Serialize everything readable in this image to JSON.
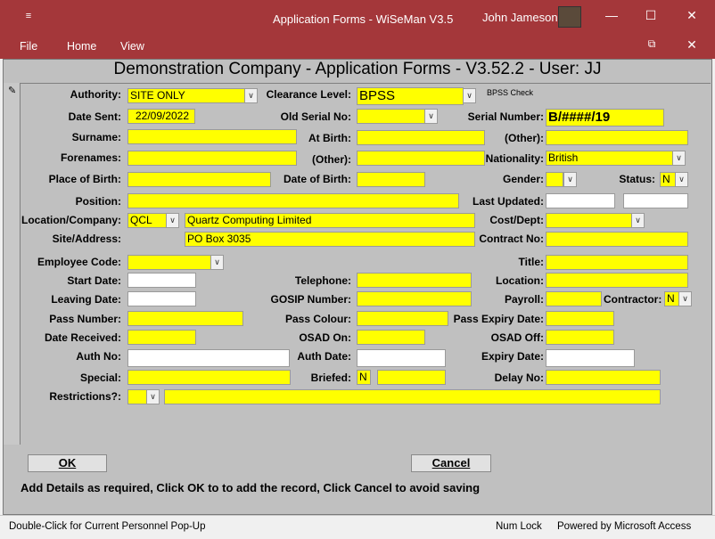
{
  "window": {
    "title": "Application Forms  -  WiSeMan V3.5",
    "user": "John Jameson"
  },
  "menu": [
    "File",
    "Home",
    "View"
  ],
  "form": {
    "title": "Demonstration Company - Application Forms - V3.52.2 - User: JJ"
  },
  "fields": {
    "authority": {
      "label": "Authority:",
      "value": "SITE ONLY"
    },
    "clearance_level": {
      "label": "Clearance Level:",
      "value": "BPSS",
      "note": "BPSS Check"
    },
    "date_sent": {
      "label": "Date Sent:",
      "value": "22/09/2022"
    },
    "old_serial_no": {
      "label": "Old Serial No:",
      "value": ""
    },
    "serial_number": {
      "label": "Serial Number:",
      "value": "B/####/19"
    },
    "surname": {
      "label": "Surname:",
      "value": ""
    },
    "at_birth": {
      "label": "At Birth:",
      "value": ""
    },
    "other1": {
      "label": "(Other):",
      "value": ""
    },
    "forenames": {
      "label": "Forenames:",
      "value": ""
    },
    "other2": {
      "label": "(Other):",
      "value": ""
    },
    "nationality": {
      "label": "Nationality:",
      "value": "British"
    },
    "place_of_birth": {
      "label": "Place of Birth:",
      "value": ""
    },
    "date_of_birth": {
      "label": "Date of Birth:",
      "value": ""
    },
    "gender": {
      "label": "Gender:",
      "value": ""
    },
    "status": {
      "label": "Status:",
      "value": "N"
    },
    "position": {
      "label": "Position:",
      "value": ""
    },
    "last_updated": {
      "label": "Last Updated:",
      "value": ""
    },
    "location_company": {
      "label": "Location/Company:",
      "code": "QCL",
      "name": "Quartz Computing Limited"
    },
    "cost_dept": {
      "label": "Cost/Dept:",
      "value": ""
    },
    "site_address": {
      "label": "Site/Address:",
      "value": "PO Box 3035"
    },
    "contract_no": {
      "label": "Contract No:",
      "value": ""
    },
    "employee_code": {
      "label": "Employee Code:",
      "value": ""
    },
    "title": {
      "label": "Title:",
      "value": ""
    },
    "start_date": {
      "label": "Start Date:",
      "value": ""
    },
    "telephone": {
      "label": "Telephone:",
      "value": ""
    },
    "location": {
      "label": "Location:",
      "value": ""
    },
    "leaving_date": {
      "label": "Leaving Date:",
      "value": ""
    },
    "gosip_number": {
      "label": "GOSIP Number:",
      "value": ""
    },
    "payroll": {
      "label": "Payroll:",
      "value": ""
    },
    "contractor": {
      "label": "Contractor:",
      "value": "N"
    },
    "pass_number": {
      "label": "Pass Number:",
      "value": ""
    },
    "pass_colour": {
      "label": "Pass Colour:",
      "value": ""
    },
    "pass_expiry_date": {
      "label": "Pass Expiry Date:",
      "value": ""
    },
    "date_received": {
      "label": "Date Received:",
      "value": ""
    },
    "osad_on": {
      "label": "OSAD On:",
      "value": ""
    },
    "osad_off": {
      "label": "OSAD Off:",
      "value": ""
    },
    "auth_no": {
      "label": "Auth No:",
      "value": ""
    },
    "auth_date": {
      "label": "Auth Date:",
      "value": ""
    },
    "expiry_date": {
      "label": "Expiry Date:",
      "value": ""
    },
    "special": {
      "label": "Special:",
      "value": ""
    },
    "briefed": {
      "label": "Briefed:",
      "value": "N"
    },
    "delay_no": {
      "label": "Delay No:",
      "value": ""
    },
    "restrictions": {
      "label": "Restrictions?:",
      "value": ""
    }
  },
  "buttons": {
    "ok": "OK",
    "cancel": "Cancel"
  },
  "instructions": "Add Details as required, Click OK to to add the record, Click Cancel to avoid saving",
  "statusbar": {
    "hint": "Double-Click for Current Personnel Pop-Up",
    "numlock": "Num Lock",
    "powered": "Powered by Microsoft Access"
  },
  "colors": {
    "titlebar": "#a4373a",
    "field": "#ffff00"
  }
}
